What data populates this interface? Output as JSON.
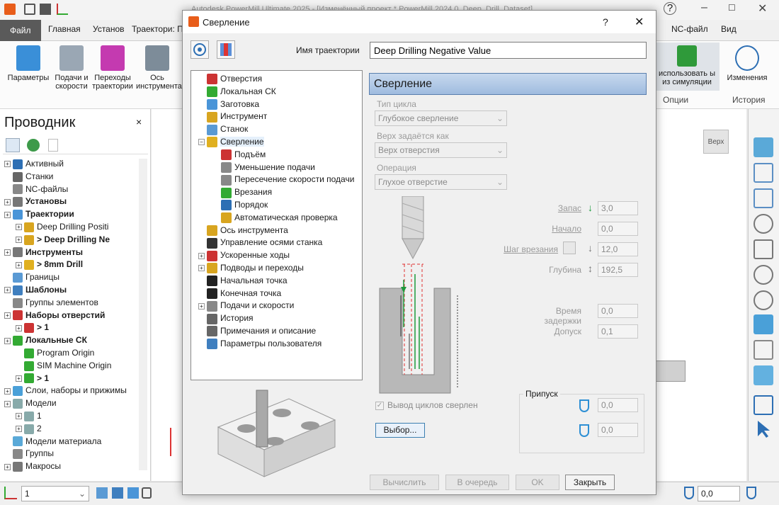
{
  "app": {
    "title": "Autodesk PowerMill Ultimate 2025 - [Изменённый проект * PowerMill 2024.0_Deep_Drill_Dataset]",
    "tabs": [
      "Файл",
      "Главная",
      "Установ",
      "Траектори: П",
      "NC-файл",
      "Вид"
    ],
    "ribbon_left": [
      "Параметры",
      "Подачи и скорости",
      "Переходы траектории",
      "Ось инструмента"
    ],
    "ribbon_right": {
      "sim_label": "использовать ы из симуляции",
      "group1": "Опции",
      "changes": "Изменения",
      "group2": "История"
    },
    "help_icon": "question-icon"
  },
  "explorer": {
    "title": "Проводник",
    "close": "×",
    "items": [
      {
        "label": "Активный",
        "bold": false
      },
      {
        "label": "Станки",
        "bold": false
      },
      {
        "label": "NC-файлы",
        "bold": false
      },
      {
        "label": "Установы",
        "bold": true
      },
      {
        "label": "Траектории",
        "bold": true
      },
      {
        "label": "Deep Drilling Positi",
        "bold": false
      },
      {
        "label": "> Deep Drilling Ne",
        "bold": true
      },
      {
        "label": "Инструменты",
        "bold": true
      },
      {
        "label": "> 8mm Drill",
        "bold": true
      },
      {
        "label": "Границы",
        "bold": false
      },
      {
        "label": "Шаблоны",
        "bold": true
      },
      {
        "label": "Группы элементов",
        "bold": false
      },
      {
        "label": "Наборы отверстий",
        "bold": true
      },
      {
        "label": "> 1",
        "bold": true
      },
      {
        "label": "Локальные СК",
        "bold": true
      },
      {
        "label": "Program Origin",
        "bold": false
      },
      {
        "label": "SIM Machine Origin",
        "bold": false
      },
      {
        "label": "> 1",
        "bold": true
      },
      {
        "label": "Слои, наборы и прижимы",
        "bold": false
      },
      {
        "label": "Модели",
        "bold": false
      },
      {
        "label": "1",
        "bold": false
      },
      {
        "label": "2",
        "bold": false
      },
      {
        "label": "Модели материала",
        "bold": false
      },
      {
        "label": "Группы",
        "bold": false
      },
      {
        "label": "Макросы",
        "bold": false
      }
    ]
  },
  "view": {
    "cube_label": "Верх"
  },
  "status": {
    "layer_value": "1",
    "right_value": "0,0"
  },
  "dialog": {
    "title": "Сверление",
    "help": "?",
    "close": "✕",
    "name_label": "Имя траектории",
    "name_value": "Deep Drilling Negative Value",
    "nav": [
      "Отверстия",
      "Локальная СК",
      "Заготовка",
      "Инструмент",
      "Станок",
      "Сверление",
      "Подъём",
      "Уменьшение подачи",
      "Пересечение скорости подачи",
      "Врезания",
      "Порядок",
      "Автоматическая проверка",
      "Ось инструмента",
      "Управление осями станка",
      "Ускоренные ходы",
      "Подводы и переходы",
      "Начальная точка",
      "Конечная точка",
      "Подачи и скорости",
      "История",
      "Примечания и описание",
      "Параметры пользователя"
    ],
    "section": "Сверление",
    "cycle_type_label": "Тип цикла",
    "cycle_type_value": "Глубокое сверление",
    "top_label": "Верх задаётся как",
    "top_value": "Верх отверстия",
    "op_label": "Операция",
    "op_value": "Глухое отверстие",
    "params": {
      "zapas": {
        "label": "Запас",
        "value": "3,0"
      },
      "nachalo": {
        "label": "Начало",
        "value": "0,0"
      },
      "shag": {
        "label": "Шаг врезания",
        "value": "12,0"
      },
      "glubina": {
        "label": "Глубина",
        "value": "192,5"
      },
      "delay": {
        "label": "Время задержки",
        "value": "0,0"
      },
      "dopusk": {
        "label": "Допуск",
        "value": "0,1"
      }
    },
    "output_cycles": "Вывод циклов сверлен",
    "select_btn": "Выбор...",
    "allowance_label": "Припуск",
    "allowance1": "0,0",
    "allowance2": "0,0",
    "buttons": {
      "calc": "Вычислить",
      "queue": "В очередь",
      "ok": "OK",
      "close": "Закрыть"
    },
    "colors": {
      "header_top": "#c7d9ee",
      "header_bottom": "#9fbbdf",
      "drill_red": "#e03030",
      "drill_green": "#1a9a3a"
    }
  }
}
